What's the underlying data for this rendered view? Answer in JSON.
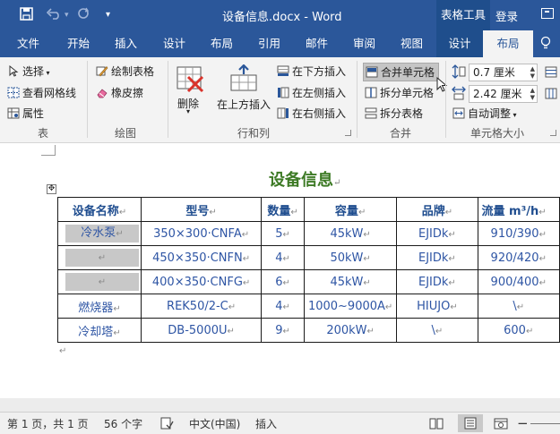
{
  "titlebar": {
    "doc_title": "设备信息.docx - Word",
    "context_label": "表格工具",
    "login": "登录"
  },
  "tabs": [
    {
      "label": "文件"
    },
    {
      "label": "开始"
    },
    {
      "label": "插入"
    },
    {
      "label": "设计"
    },
    {
      "label": "布局"
    },
    {
      "label": "引用"
    },
    {
      "label": "邮件"
    },
    {
      "label": "审阅"
    },
    {
      "label": "视图"
    },
    {
      "label": "设计"
    },
    {
      "label": "布局"
    }
  ],
  "ribbon": {
    "table": {
      "select": "选择",
      "view_gridlines": "查看网格线",
      "properties": "属性",
      "label": "表"
    },
    "draw": {
      "draw_table": "绘制表格",
      "eraser": "橡皮擦",
      "label": "绘图"
    },
    "rows_cols": {
      "delete": "删除",
      "insert_above": "在上方插入",
      "insert_below": "在下方插入",
      "insert_left": "在左侧插入",
      "insert_right": "在右侧插入",
      "label": "行和列"
    },
    "merge": {
      "merge_cells": "合并单元格",
      "split_cells": "拆分单元格",
      "split_table": "拆分表格",
      "label": "合并"
    },
    "cell_size": {
      "height": "0.7 厘米",
      "width": "2.42 厘米",
      "autofit": "自动调整",
      "label": "单元格大小"
    }
  },
  "document": {
    "heading": "设备信息",
    "pilcrow": "↵",
    "table": {
      "headers": [
        "设备名称",
        "型号",
        "数量",
        "容量",
        "品牌",
        "流量 m³/h"
      ],
      "rows": [
        [
          "冷水泵",
          "350×300·CNFA",
          "5",
          "45kW",
          "EJIDk",
          "910/390"
        ],
        [
          "",
          "450×350·CNFN",
          "4",
          "50kW",
          "EJIDk",
          "920/420"
        ],
        [
          "",
          "400×350·CNFG",
          "6",
          "45kW",
          "EJIDk",
          "900/400"
        ],
        [
          "燃烧器",
          "REK50/2-C",
          "4",
          "1000~9000A",
          "HIUJO",
          "\\"
        ],
        [
          "冷却塔",
          "DB-5000U",
          "9",
          "200kW",
          "\\",
          "600"
        ]
      ]
    }
  },
  "statusbar": {
    "page": "第 1 页，共 1 页",
    "words": "56 个字",
    "language": "中文(中国)",
    "mode": "插入"
  },
  "colors": {
    "brand": "#2b579a",
    "heading": "#3d7a25",
    "cell_text": "#2e55a4",
    "selected_cell": "#c8c8c8"
  }
}
